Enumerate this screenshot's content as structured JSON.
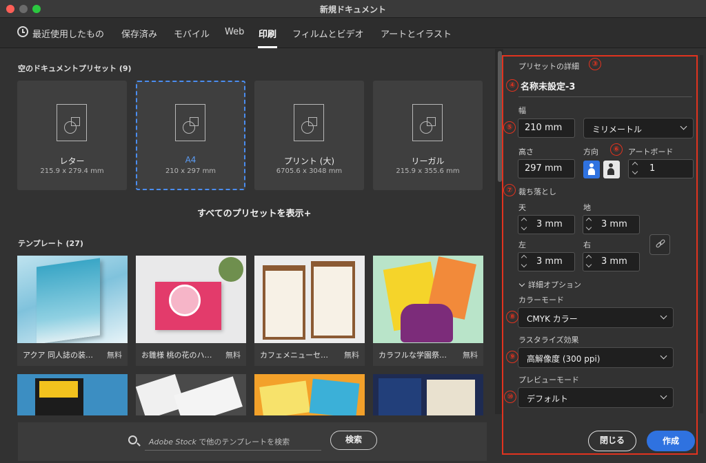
{
  "window": {
    "title": "新規ドキュメント"
  },
  "tabs": [
    {
      "label": "最近使用したもの",
      "active": false
    },
    {
      "label": "保存済み",
      "active": false
    },
    {
      "label": "モバイル",
      "active": false
    },
    {
      "label": "Web",
      "active": false
    },
    {
      "label": "印刷",
      "active": true
    },
    {
      "label": "フィルムとビデオ",
      "active": false
    },
    {
      "label": "アートとイラスト",
      "active": false
    }
  ],
  "presets": {
    "heading": "空のドキュメントプリセット",
    "count": "(9)",
    "items": [
      {
        "name": "レター",
        "size": "215.9 x 279.4 mm",
        "selected": false
      },
      {
        "name": "A4",
        "size": "210 x 297 mm",
        "selected": true
      },
      {
        "name": "プリント (大)",
        "size": "6705.6 x 3048 mm",
        "selected": false
      },
      {
        "name": "リーガル",
        "size": "215.9 x 355.6 mm",
        "selected": false
      }
    ],
    "show_all": "すべてのプリセットを表示+"
  },
  "templates": {
    "heading": "テンプレート",
    "count": "(27)",
    "items": [
      {
        "name": "アクア 同人誌の装…",
        "price": "無料"
      },
      {
        "name": "お雛様 桃の花のハ…",
        "price": "無料"
      },
      {
        "name": "カフェメニューセ…",
        "price": "無料"
      },
      {
        "name": "カラフルな学園祭…",
        "price": "無料"
      }
    ]
  },
  "search": {
    "placeholder_brand": "Adobe Stock",
    "placeholder_rest": " で他のテンプレートを検索",
    "button": "検索"
  },
  "details": {
    "heading": "プリセットの詳細",
    "doc_name": "名称未設定-3",
    "width_label": "幅",
    "width_value": "210 mm",
    "unit_value": "ミリメートル",
    "height_label": "高さ",
    "height_value": "297 mm",
    "orientation_label": "方向",
    "artboard_label": "アートボード",
    "artboard_value": "1",
    "bleed_label": "裁ち落とし",
    "bleed_top_label": "天",
    "bleed_top": "3 mm",
    "bleed_bottom_label": "地",
    "bleed_bottom": "3 mm",
    "bleed_left_label": "左",
    "bleed_left": "3 mm",
    "bleed_right_label": "右",
    "bleed_right": "3 mm",
    "advanced_label": "詳細オプション",
    "color_mode_label": "カラーモード",
    "color_mode_value": "CMYK カラー",
    "raster_label": "ラスタライズ効果",
    "raster_value": "高解像度 (300 ppi)",
    "preview_label": "プレビューモード",
    "preview_value": "デフォルト",
    "close_button": "閉じる",
    "create_button": "作成"
  },
  "annotations": [
    "③",
    "④",
    "⑤",
    "⑥",
    "⑦",
    "⑧",
    "⑨",
    "⑩"
  ],
  "colors": {
    "accent": "#2f72e0",
    "selection": "#4b8df0",
    "annotation_red": "#e2331f"
  }
}
